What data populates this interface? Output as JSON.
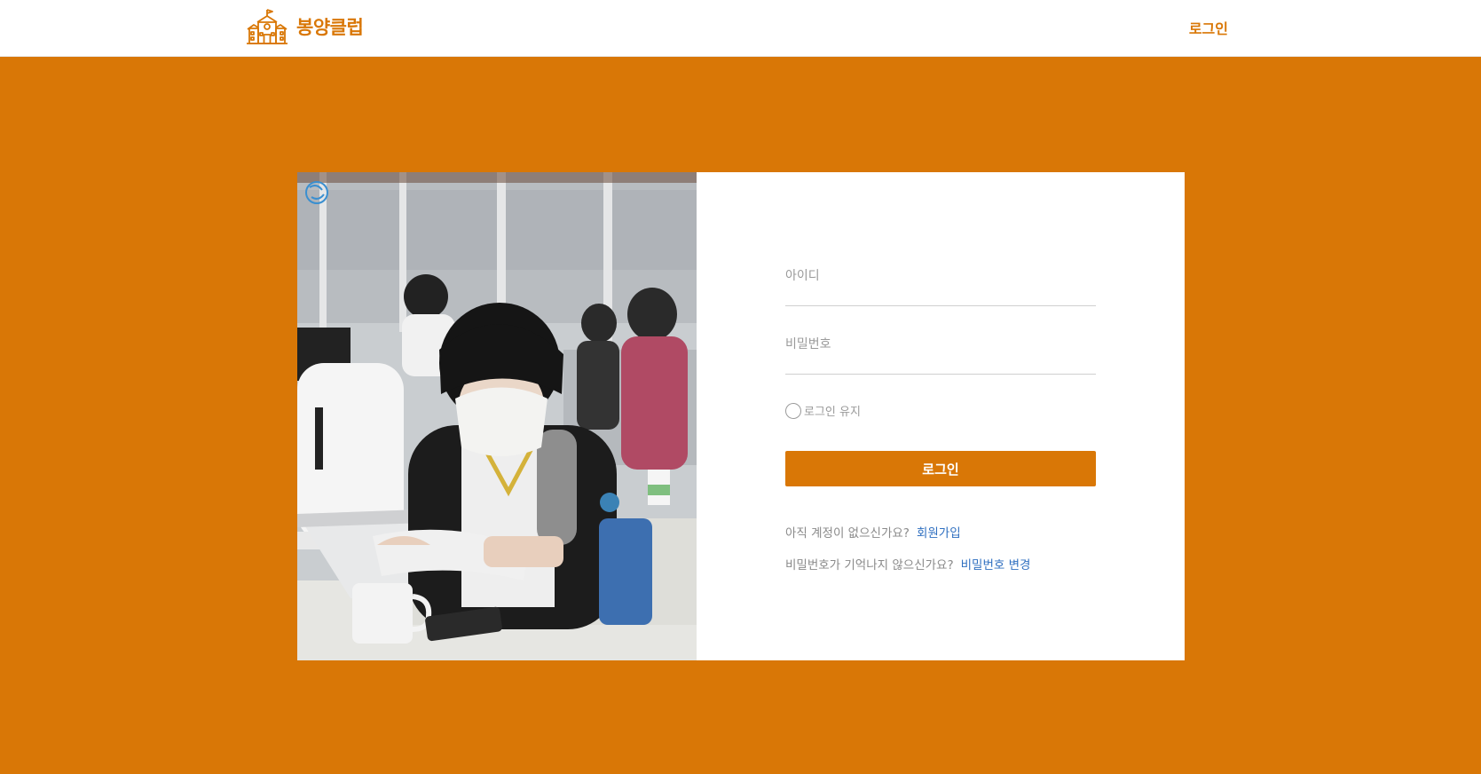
{
  "header": {
    "brand_name": "봉양클럽",
    "login_link": "로그인"
  },
  "login_form": {
    "id_placeholder": "아이디",
    "password_placeholder": "비밀번호",
    "remember_label": "로그인 유지",
    "submit_label": "로그인",
    "signup_prompt": "아직 계정이 없으신가요?",
    "signup_link": "회원가입",
    "forgot_prompt": "비밀번호가 기억나지 않으신가요?",
    "change_password_link": "비밀번호 변경"
  },
  "colors": {
    "accent": "#d97706",
    "link": "#2f6fc0",
    "panel_background": "#ffffff"
  }
}
